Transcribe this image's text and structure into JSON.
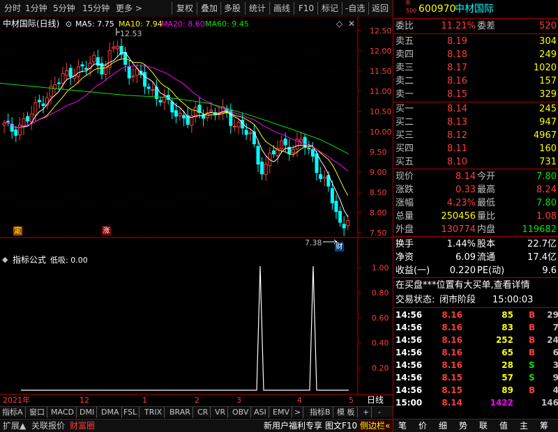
{
  "toolbar": {
    "left": [
      "分时",
      "1分钟",
      "5分钟",
      "15分钟",
      "更多 >"
    ],
    "right": [
      "复权",
      "叠加",
      "多股",
      "统计",
      "画线",
      "F10",
      "标记",
      "-自选",
      "返回"
    ]
  },
  "main_chart": {
    "title": "中材国际(日线)",
    "ma5": "MA5: 7.75",
    "ma10": "MA10: 7.94",
    "ma20": "MA20: 8.60",
    "ma60": "MA60: 9.45",
    "high_label": "12.53",
    "low_label": "7.38",
    "marker_ding": "定",
    "marker_zhang": "涨",
    "marker_cai": "财",
    "price_ticks": [
      "12.50",
      "12.00",
      "11.50",
      "11.00",
      "10.50",
      "10.00",
      "9.50",
      "9.00",
      "8.50",
      "8.00",
      "7.50"
    ]
  },
  "indicator": {
    "title": "指标公式",
    "value": "低吸: 0.00",
    "ticks": [
      "1.00",
      "0.80",
      "0.60",
      "0.40",
      "0.20"
    ]
  },
  "timeline": {
    "labels": [
      "2021年",
      "12",
      "1",
      "2",
      "3",
      "4",
      "5"
    ],
    "period_label": "日线"
  },
  "indicator_tabs": [
    "指标A",
    "窗口",
    "MACD",
    "DMI",
    "DMA",
    "FSL",
    "TRIX",
    "BRAR",
    "CR",
    "VR",
    "OBV",
    "ASI",
    "EMV",
    ">",
    "指标B",
    "模 板",
    "+",
    "-"
  ],
  "bottom_bar": {
    "left": [
      "扩展▲",
      "关联报价",
      "财富圈"
    ],
    "promo": "新用户福利专享",
    "f10": "图文F10",
    "sidebar": "侧边栏«",
    "right_tabs": [
      "笔",
      "价",
      "细",
      "势",
      "联",
      "值",
      "主",
      "筹"
    ]
  },
  "stock": {
    "badge_top": "R",
    "badge_bottom": "500",
    "code": "600970",
    "name": "中材国际"
  },
  "order_book": {
    "weibi_label": "委比",
    "weibi_value": "11.21%",
    "weicha_label": "委差",
    "weicha_value": "520",
    "asks": [
      {
        "label": "卖五",
        "price": "8.19",
        "vol": "304"
      },
      {
        "label": "卖四",
        "price": "8.18",
        "vol": "249"
      },
      {
        "label": "卖三",
        "price": "8.17",
        "vol": "1020"
      },
      {
        "label": "卖二",
        "price": "8.16",
        "vol": "157"
      },
      {
        "label": "卖一",
        "price": "8.15",
        "vol": "329"
      }
    ],
    "bids": [
      {
        "label": "买一",
        "price": "8.14",
        "vol": "245"
      },
      {
        "label": "买二",
        "price": "8.13",
        "vol": "947"
      },
      {
        "label": "买三",
        "price": "8.12",
        "vol": "4967"
      },
      {
        "label": "买四",
        "price": "8.11",
        "vol": "160"
      },
      {
        "label": "买五",
        "price": "8.10",
        "vol": "731"
      }
    ]
  },
  "quote": [
    {
      "l1": "现价",
      "v1": "8.14",
      "l2": "今开",
      "v2": "7.80",
      "c1": "red",
      "c2": "green"
    },
    {
      "l1": "涨跌",
      "v1": "0.33",
      "l2": "最高",
      "v2": "8.24",
      "c1": "red",
      "c2": "red"
    },
    {
      "l1": "涨幅",
      "v1": "4.23%",
      "l2": "最低",
      "v2": "7.80",
      "c1": "red",
      "c2": "green"
    },
    {
      "l1": "总量",
      "v1": "250456",
      "l2": "量比",
      "v2": "1.08",
      "c1": "yellow",
      "c2": "red"
    },
    {
      "l1": "外盘",
      "v1": "130774",
      "l2": "内盘",
      "v2": "119682",
      "c1": "red",
      "c2": "green"
    }
  ],
  "fundamentals": [
    {
      "l1": "换手",
      "v1": "1.44%",
      "l2": "股本",
      "v2": "22.7亿"
    },
    {
      "l1": "净资",
      "v1": "6.09",
      "l2": "流通",
      "v2": "17.4亿"
    },
    {
      "l1": "收益(一)",
      "v1": "0.220",
      "l2": "PE(动)",
      "v2": "9.6"
    }
  ],
  "notice": "在买盘***位置有大买单,查看详情",
  "trade_status_label": "交易状态:",
  "trade_status_value": "闭市阶段",
  "trade_status_time": "15:00:03",
  "trades": [
    {
      "time": "14:56",
      "price": "8.16",
      "vol": "85",
      "side": "B",
      "num": "29"
    },
    {
      "time": "14:56",
      "price": "8.16",
      "vol": "83",
      "side": "B",
      "num": "7"
    },
    {
      "time": "14:56",
      "price": "8.16",
      "vol": "252",
      "side": "B",
      "num": "24"
    },
    {
      "time": "14:56",
      "price": "8.16",
      "vol": "65",
      "side": "B",
      "num": "6"
    },
    {
      "time": "14:56",
      "price": "8.16",
      "vol": "28",
      "side": "S",
      "num": "3"
    },
    {
      "time": "14:56",
      "price": "8.15",
      "vol": "57",
      "side": "S",
      "num": "9"
    },
    {
      "time": "14:56",
      "price": "8.15",
      "vol": "89",
      "side": "B",
      "num": "4"
    },
    {
      "time": "15:00",
      "price": "8.14",
      "vol": "1422",
      "side": "",
      "num": "146"
    }
  ],
  "colors": {
    "up": "#ff3c3c",
    "down": "#00ffff",
    "ma5": "#ffffff",
    "ma10": "#ffff00",
    "ma20": "#ff00ff",
    "ma60": "#00e600",
    "border": "#b00000"
  }
}
